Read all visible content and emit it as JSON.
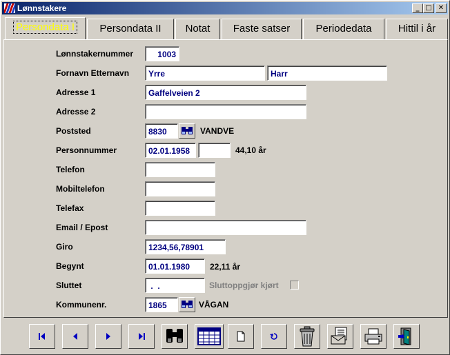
{
  "window": {
    "title": "Lønnstakere",
    "minimize_glyph": "_",
    "maximize_glyph": "□",
    "close_glyph": "✕"
  },
  "tabs": [
    {
      "label": "Persondata I",
      "active": true
    },
    {
      "label": "Persondata II",
      "active": false
    },
    {
      "label": "Notat",
      "active": false
    },
    {
      "label": "Faste satser",
      "active": false
    },
    {
      "label": "Periodedata",
      "active": false
    },
    {
      "label": "Hittil i år",
      "active": false
    }
  ],
  "form": {
    "employee_number": {
      "label": "Lønnstakernummer",
      "value": "1003"
    },
    "name": {
      "label": "Fornavn Etternavn",
      "first": "Yrre",
      "last": "Harr"
    },
    "address1": {
      "label": "Adresse 1",
      "value": "Gaffelveien 2"
    },
    "address2": {
      "label": "Adresse 2",
      "value": ""
    },
    "postal": {
      "label": "Poststed",
      "code": "8830",
      "place": "VANDVE"
    },
    "person_number": {
      "label": "Personnummer",
      "date": "02.01.1958",
      "suffix": "",
      "age": "44,10 år"
    },
    "phone": {
      "label": "Telefon",
      "value": ""
    },
    "mobile": {
      "label": "Mobiltelefon",
      "value": ""
    },
    "fax": {
      "label": "Telefax",
      "value": ""
    },
    "email": {
      "label": "Email / Epost",
      "value": ""
    },
    "giro": {
      "label": "Giro",
      "value": "1234,56,78901"
    },
    "started": {
      "label": "Begynt",
      "value": "01.01.1980",
      "years": "22,11 år"
    },
    "ended": {
      "label": "Sluttet",
      "value": " .  .",
      "settlement_label": "Sluttoppgjør kjørt",
      "settlement_checked": false
    },
    "municipality": {
      "label": "Kommunenr.",
      "code": "1865",
      "name": "VÅGAN"
    }
  },
  "colors": {
    "face": "#d4d0c8",
    "title_start": "#0a246a",
    "title_end": "#a6caf0",
    "field_text": "#000080",
    "active_tab_text": "#ffff00",
    "nav_icon": "#0000c0"
  }
}
